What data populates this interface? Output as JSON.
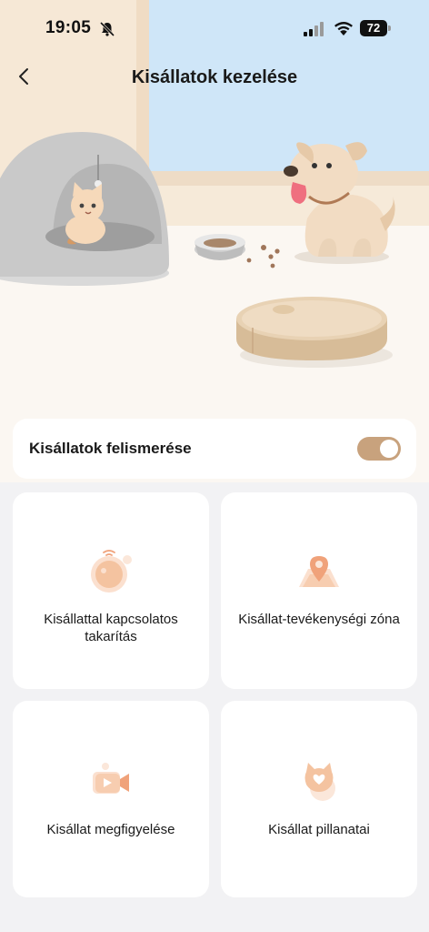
{
  "status_bar": {
    "time": "19:05",
    "battery": "72",
    "icons": [
      "bell-slash-icon",
      "cellular-signal-icon",
      "wifi-icon",
      "battery-icon"
    ]
  },
  "nav": {
    "title": "Kisállatok kezelése",
    "back_icon": "chevron-left-icon"
  },
  "hero": {
    "illustration": "pet-home-illustration"
  },
  "recognition": {
    "label": "Kisállatok felismerése",
    "enabled": true
  },
  "tiles": [
    {
      "label": "Kisállattal kapcsolatos takarítás",
      "icon": "robot-vacuum-icon"
    },
    {
      "label": "Kisállat-tevékenységi zóna",
      "icon": "location-pin-icon"
    },
    {
      "label": "Kisállat megfigyelése",
      "icon": "video-camera-icon"
    },
    {
      "label": "Kisállat pillanatai",
      "icon": "cat-heart-icon"
    }
  ],
  "colors": {
    "accent": "#c8a27d",
    "icon_tint": "#f2c4a4",
    "background": "#f2f2f4"
  }
}
